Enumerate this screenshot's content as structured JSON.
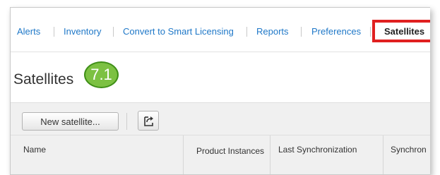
{
  "nav": {
    "items": [
      "Alerts",
      "Inventory",
      "Convert to Smart Licensing",
      "Reports",
      "Preferences"
    ],
    "active": "Satellites"
  },
  "page": {
    "title": "Satellites",
    "step_badge": "7.1"
  },
  "toolbar": {
    "new_button": "New satellite...",
    "export_icon": "export-icon"
  },
  "table": {
    "headers": {
      "name": "Name",
      "product_instances": "Product Instances",
      "last_sync": "Last Synchronization",
      "synchro": "Synchron"
    }
  },
  "colors": {
    "link": "#1f78c8",
    "highlight": "#e02020",
    "badge": "#7cc142"
  }
}
